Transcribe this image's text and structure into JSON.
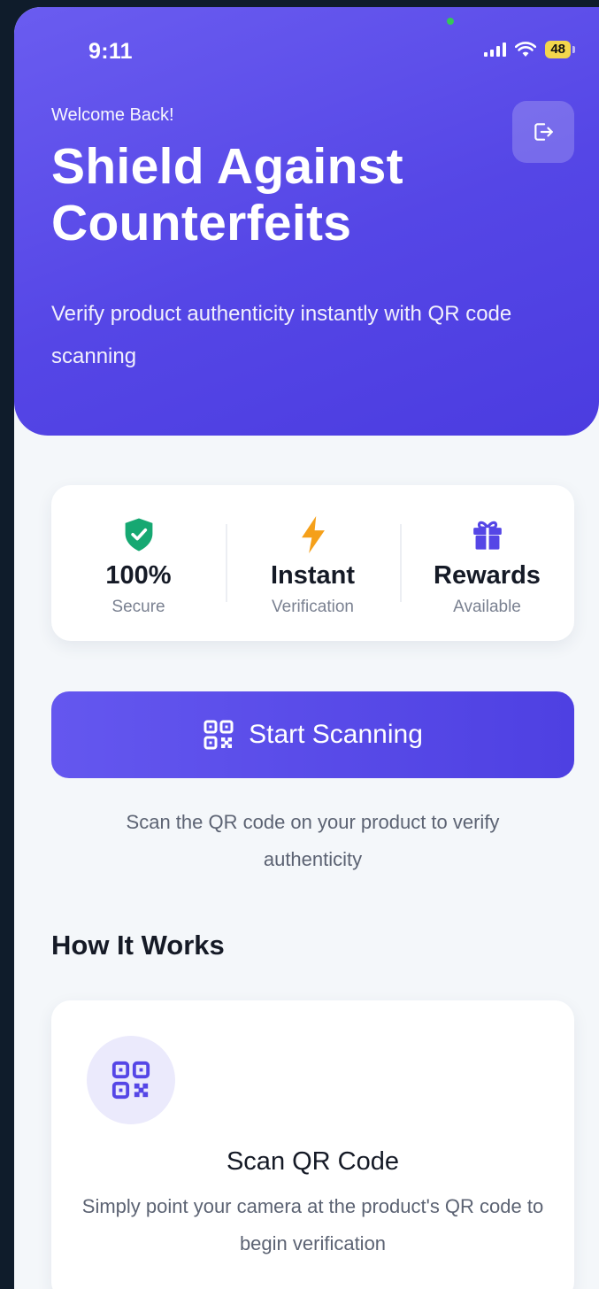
{
  "status_bar": {
    "time": "9:11",
    "battery": "48"
  },
  "header": {
    "welcome": "Welcome Back!",
    "title": "Shield Against Counterfeits",
    "subtitle": "Verify product authenticity instantly with QR code scanning"
  },
  "stats": [
    {
      "icon": "shield-check-icon",
      "value": "100%",
      "label": "Secure",
      "color": "#16a872"
    },
    {
      "icon": "lightning-icon",
      "value": "Instant",
      "label": "Verification",
      "color": "#f5a01a"
    },
    {
      "icon": "gift-icon",
      "value": "Rewards",
      "label": "Available",
      "color": "#5546e6"
    }
  ],
  "cta": {
    "label": "Start Scanning",
    "hint": "Scan the QR code on your product to verify authenticity"
  },
  "how_it_works": {
    "title": "How It Works",
    "steps": [
      {
        "icon": "qr-code-icon",
        "title": "Scan QR Code",
        "description": "Simply point your camera at the product's QR code to begin verification"
      }
    ]
  },
  "colors": {
    "primary": "#5546e6",
    "background": "#f4f7fa"
  }
}
